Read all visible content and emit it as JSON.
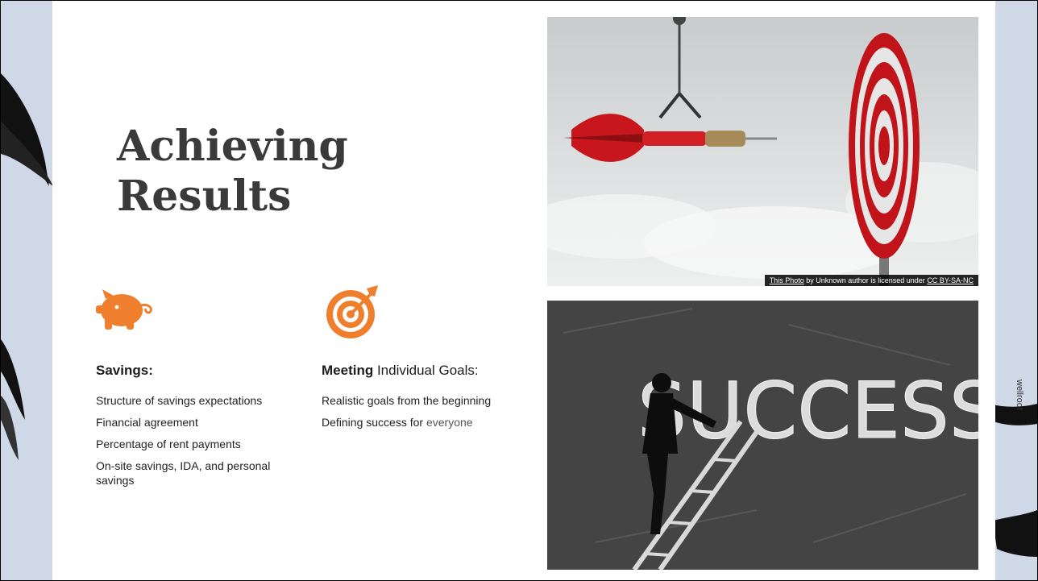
{
  "slide": {
    "title_line1": "Achieving",
    "title_line2": "Results",
    "left_column": {
      "icon": "piggy-bank-icon",
      "heading": "Savings:",
      "items": [
        "Structure of savings expectations",
        "Financial agreement",
        "Percentage of rent payments",
        "On-site savings, IDA, and personal savings"
      ]
    },
    "right_column": {
      "icon": "target-arrow-icon",
      "heading_bold": "Meeting",
      "heading_rest": " Individual Goals:",
      "items": [
        "Realistic goals from the beginning",
        "Defining success for "
      ],
      "item2_suffix": "everyone"
    },
    "photo_top": {
      "caption_link1": "This Photo",
      "caption_mid": " by Unknown author is licensed under ",
      "caption_link2": "CC BY-SA-NC"
    },
    "photo_bottom": {
      "word": "SUCCESS"
    },
    "side_text": "wellroot"
  },
  "colors": {
    "accent": "#ef7f2d",
    "title": "#3a3a3a",
    "frame": "#cfd8e6"
  }
}
